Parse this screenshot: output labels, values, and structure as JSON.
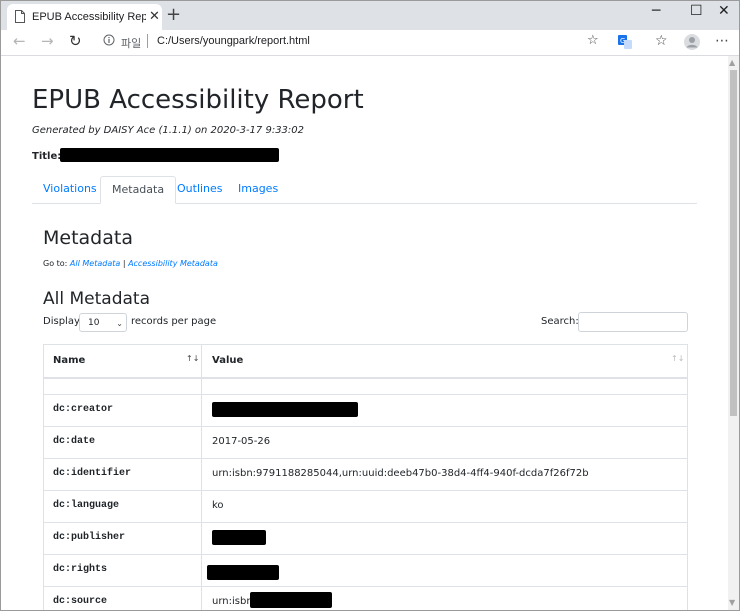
{
  "browser": {
    "tab_title": "EPUB Accessibility Report by DAISY Ace",
    "new_tab": "+",
    "scheme_label": "파일",
    "url": "C:/Users/youngpark/report.html"
  },
  "report": {
    "title": "EPUB Accessibility Report",
    "generated": "Generated by DAISY Ace (1.1.1) on 2020-3-17 9:33:02",
    "title_label": "Title:"
  },
  "tabs": [
    "Violations",
    "Metadata",
    "Outlines",
    "Images"
  ],
  "metadata_section": {
    "heading": "Metadata",
    "goto_label": "Go to:",
    "goto_links": [
      "All Metadata",
      "Accessibility Metadata"
    ],
    "goto_sep": "|"
  },
  "all_metadata": {
    "heading": "All Metadata",
    "display_label": "Display",
    "page_size": "10",
    "records_label": "records per page",
    "search_label": "Search:",
    "search_value": ""
  },
  "table": {
    "columns": [
      "Name",
      "Value"
    ],
    "rows": [
      {
        "name": "",
        "value": ""
      },
      {
        "name": "dc:creator",
        "value": ""
      },
      {
        "name": "dc:date",
        "value": "2017-05-26"
      },
      {
        "name": "dc:identifier",
        "value": "urn:isbn:9791188285044,urn:uuid:deeb47b0-38d4-4ff4-940f-dcda7f26f72b"
      },
      {
        "name": "dc:language",
        "value": "ko"
      },
      {
        "name": "dc:publisher",
        "value": ""
      },
      {
        "name": "dc:rights",
        "value": ""
      },
      {
        "name": "dc:source",
        "value": "urn:isbn"
      }
    ]
  }
}
